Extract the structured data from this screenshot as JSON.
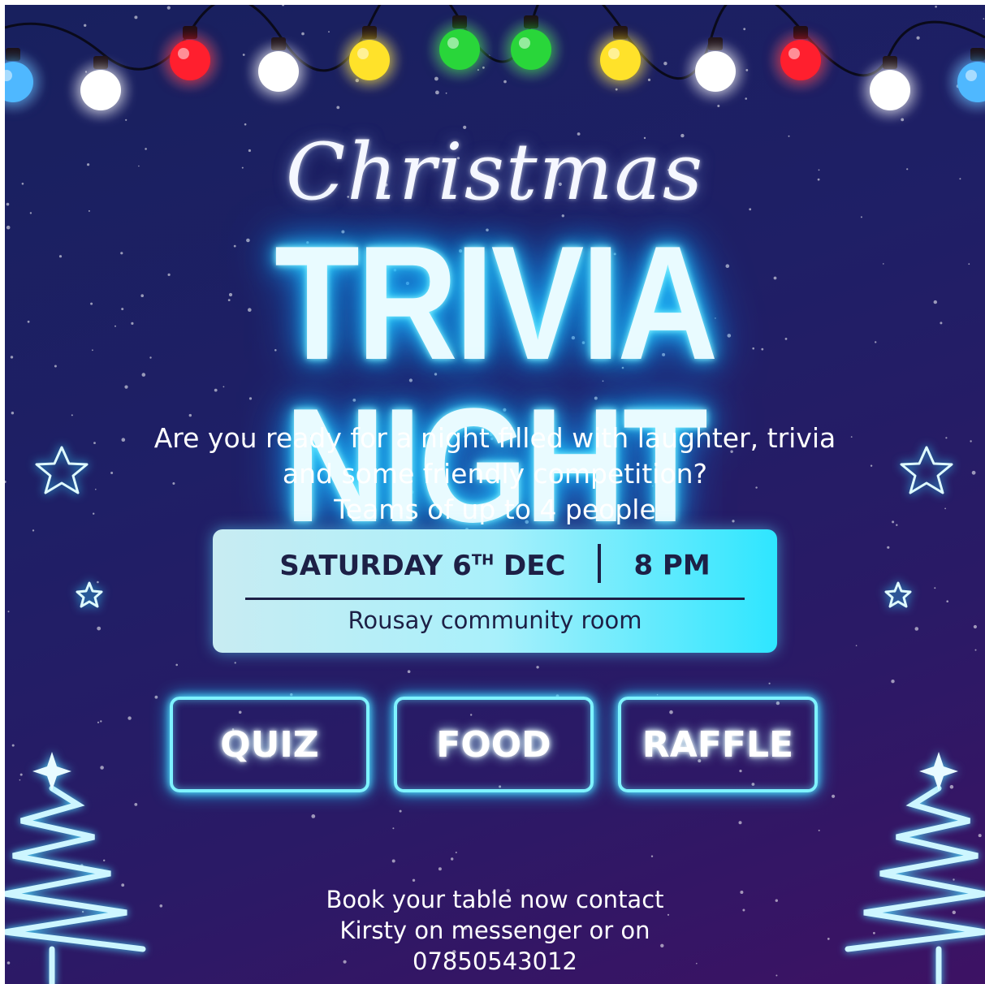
{
  "poster": {
    "script_title": "Christmas",
    "main_title": "TRIVIA NIGHT",
    "intro_lines": [
      "Are you ready for a night filled with laughter, trivia",
      "and some friendly competition?",
      "Teams of up to 4 people"
    ],
    "date_day": "SATURDAY 6",
    "date_suffix": "TH",
    "date_month": "DEC",
    "time": "8 PM",
    "venue": "Rousay community room",
    "features": [
      "QUIZ",
      "FOOD",
      "RAFFLE"
    ],
    "footer_lines": [
      "Book your table now contact",
      "Kirsty on messenger or on",
      "07850543012"
    ]
  },
  "colors": {
    "neon_cyan": "#33d9ff",
    "text_dark": "#1d2046",
    "bulb_colors": [
      "#ffffff",
      "#ff1f2e",
      "#ffe22a",
      "#29d63a",
      "#4fb8ff"
    ]
  },
  "icons": [
    "string-lights-icon",
    "bulb-icon",
    "star-icon",
    "christmas-tree-icon",
    "snow-dots"
  ]
}
